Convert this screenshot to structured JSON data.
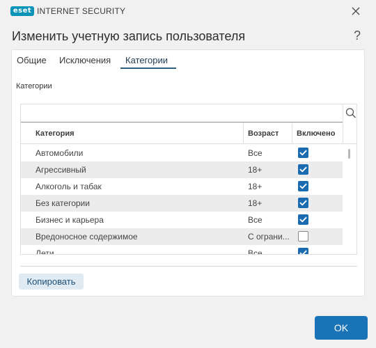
{
  "window": {
    "brand_logo": "eset",
    "app_name": "INTERNET SECURITY",
    "close_icon": "close-icon",
    "dialog_title": "Изменить учетную запись пользователя",
    "help_label": "?"
  },
  "tabs": [
    {
      "label": "Общие"
    },
    {
      "label": "Исключения"
    },
    {
      "label": "Категории",
      "active": true
    }
  ],
  "section_label": "Категории",
  "search": {
    "value": "",
    "placeholder": "",
    "icon": "search-icon"
  },
  "table": {
    "columns": [
      "Категория",
      "Возраст",
      "Включено"
    ],
    "rows": [
      {
        "category": "Автомобили",
        "age": "Все",
        "enabled": true
      },
      {
        "category": "Агрессивный",
        "age": "18+",
        "enabled": true
      },
      {
        "category": "Алкоголь и табак",
        "age": "18+",
        "enabled": true
      },
      {
        "category": "Без категории",
        "age": "18+",
        "enabled": true
      },
      {
        "category": "Бизнес и карьера",
        "age": "Все",
        "enabled": true
      },
      {
        "category": "Вредоносное содержимое",
        "age": "С ограни...",
        "enabled": false
      },
      {
        "category": "Дети",
        "age": "Все",
        "enabled": true
      }
    ]
  },
  "buttons": {
    "copy": "Копировать",
    "ok": "OK"
  },
  "colors": {
    "accent": "#1a73b6",
    "checkbox": "#1b6bb0",
    "brand": "#0b93b8",
    "copy_bg": "#dfeaf3"
  }
}
